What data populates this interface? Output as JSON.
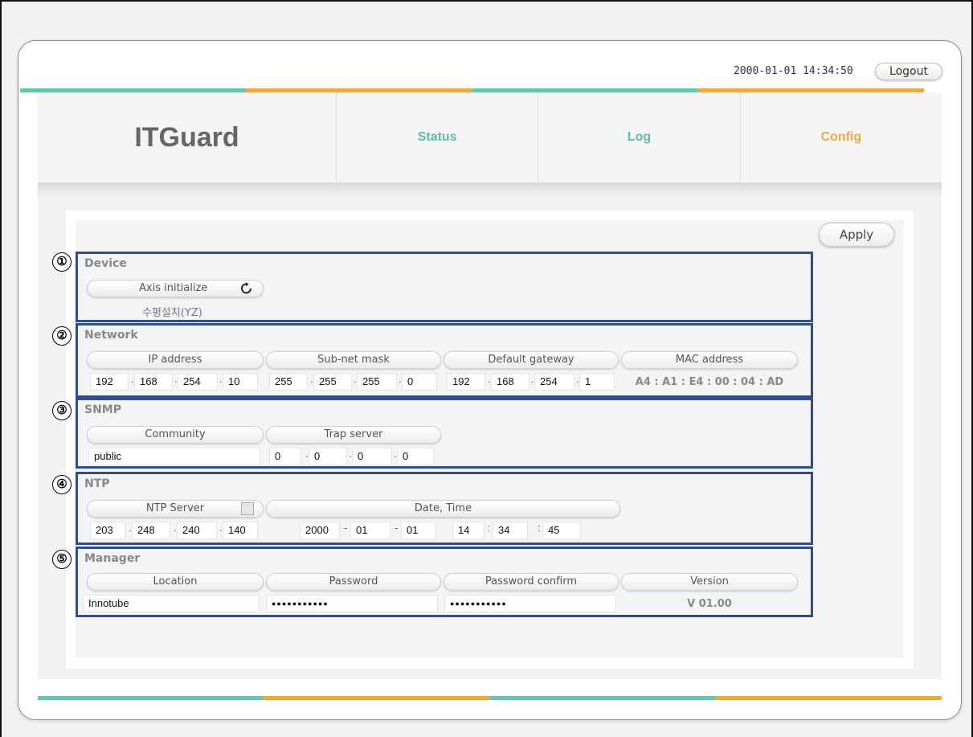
{
  "header": {
    "datetime": "2000-01-01 14:34:50",
    "logout_label": "Logout",
    "brand": "ITGuard",
    "nav": [
      "Status",
      "Log",
      "Config"
    ]
  },
  "apply_label": "Apply",
  "sections": {
    "device": {
      "num": "①",
      "title": "Device",
      "axis_label": "Axis initialize",
      "install_text": "수평설치(YZ)"
    },
    "network": {
      "num": "②",
      "title": "Network",
      "ip_label": "IP address",
      "ip": [
        "192",
        "168",
        "254",
        "10"
      ],
      "mask_label": "Sub-net mask",
      "mask": [
        "255",
        "255",
        "255",
        "0"
      ],
      "gateway_label": "Default gateway",
      "gateway": [
        "192",
        "168",
        "254",
        "1"
      ],
      "mac_label": "MAC address",
      "mac": "A4 : A1 : E4 : 00 : 04 : AD"
    },
    "snmp": {
      "num": "③",
      "title": "SNMP",
      "community_label": "Community",
      "community": "public",
      "trap_label": "Trap server",
      "trap": [
        "0",
        "0",
        "0",
        "0"
      ]
    },
    "ntp": {
      "num": "④",
      "title": "NTP",
      "server_label": "NTP Server",
      "server": [
        "203",
        "248",
        "240",
        "140"
      ],
      "datetime_label": "Date, Time",
      "date": [
        "2000",
        "01",
        "01"
      ],
      "time": [
        "14",
        "34",
        "45"
      ]
    },
    "manager": {
      "num": "⑤",
      "title": "Manager",
      "location_label": "Location",
      "location": "Innotube",
      "password_label": "Password",
      "password": "●●●●●●●●●●●",
      "confirm_label": "Password confirm",
      "confirm": "●●●●●●●●●●●",
      "version_label": "Version",
      "version": "V 01.00"
    }
  },
  "colors": {
    "teal": "#6cc4b0",
    "orange": "#f0a845",
    "section_border": "#2f4f8c"
  },
  "icons": {
    "refresh": "refresh-icon",
    "checkbox": "ntp-checkbox"
  }
}
